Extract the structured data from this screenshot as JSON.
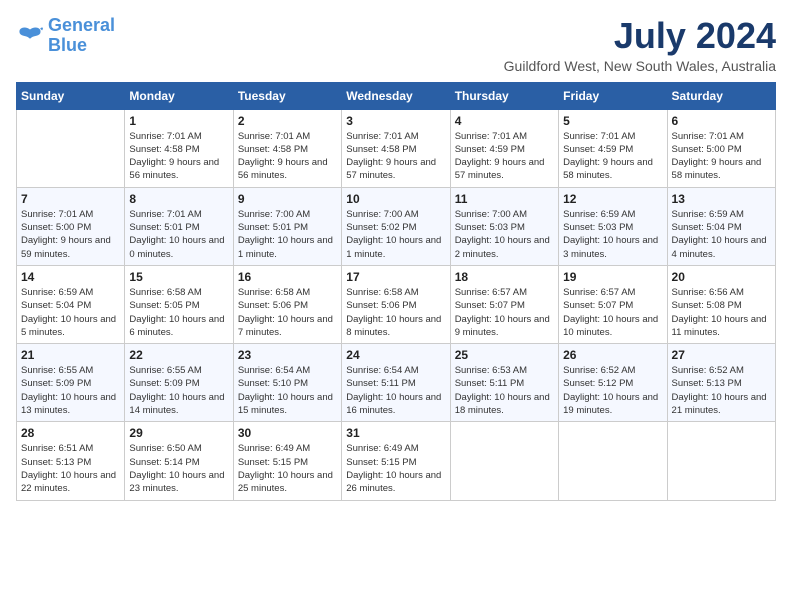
{
  "logo": {
    "line1": "General",
    "line2": "Blue"
  },
  "title": "July 2024",
  "subtitle": "Guildford West, New South Wales, Australia",
  "headers": [
    "Sunday",
    "Monday",
    "Tuesday",
    "Wednesday",
    "Thursday",
    "Friday",
    "Saturday"
  ],
  "weeks": [
    [
      {
        "day": "",
        "sunrise": "",
        "sunset": "",
        "daylight": ""
      },
      {
        "day": "1",
        "sunrise": "Sunrise: 7:01 AM",
        "sunset": "Sunset: 4:58 PM",
        "daylight": "Daylight: 9 hours and 56 minutes."
      },
      {
        "day": "2",
        "sunrise": "Sunrise: 7:01 AM",
        "sunset": "Sunset: 4:58 PM",
        "daylight": "Daylight: 9 hours and 56 minutes."
      },
      {
        "day": "3",
        "sunrise": "Sunrise: 7:01 AM",
        "sunset": "Sunset: 4:58 PM",
        "daylight": "Daylight: 9 hours and 57 minutes."
      },
      {
        "day": "4",
        "sunrise": "Sunrise: 7:01 AM",
        "sunset": "Sunset: 4:59 PM",
        "daylight": "Daylight: 9 hours and 57 minutes."
      },
      {
        "day": "5",
        "sunrise": "Sunrise: 7:01 AM",
        "sunset": "Sunset: 4:59 PM",
        "daylight": "Daylight: 9 hours and 58 minutes."
      },
      {
        "day": "6",
        "sunrise": "Sunrise: 7:01 AM",
        "sunset": "Sunset: 5:00 PM",
        "daylight": "Daylight: 9 hours and 58 minutes."
      }
    ],
    [
      {
        "day": "7",
        "sunrise": "Sunrise: 7:01 AM",
        "sunset": "Sunset: 5:00 PM",
        "daylight": "Daylight: 9 hours and 59 minutes."
      },
      {
        "day": "8",
        "sunrise": "Sunrise: 7:01 AM",
        "sunset": "Sunset: 5:01 PM",
        "daylight": "Daylight: 10 hours and 0 minutes."
      },
      {
        "day": "9",
        "sunrise": "Sunrise: 7:00 AM",
        "sunset": "Sunset: 5:01 PM",
        "daylight": "Daylight: 10 hours and 1 minute."
      },
      {
        "day": "10",
        "sunrise": "Sunrise: 7:00 AM",
        "sunset": "Sunset: 5:02 PM",
        "daylight": "Daylight: 10 hours and 1 minute."
      },
      {
        "day": "11",
        "sunrise": "Sunrise: 7:00 AM",
        "sunset": "Sunset: 5:03 PM",
        "daylight": "Daylight: 10 hours and 2 minutes."
      },
      {
        "day": "12",
        "sunrise": "Sunrise: 6:59 AM",
        "sunset": "Sunset: 5:03 PM",
        "daylight": "Daylight: 10 hours and 3 minutes."
      },
      {
        "day": "13",
        "sunrise": "Sunrise: 6:59 AM",
        "sunset": "Sunset: 5:04 PM",
        "daylight": "Daylight: 10 hours and 4 minutes."
      }
    ],
    [
      {
        "day": "14",
        "sunrise": "Sunrise: 6:59 AM",
        "sunset": "Sunset: 5:04 PM",
        "daylight": "Daylight: 10 hours and 5 minutes."
      },
      {
        "day": "15",
        "sunrise": "Sunrise: 6:58 AM",
        "sunset": "Sunset: 5:05 PM",
        "daylight": "Daylight: 10 hours and 6 minutes."
      },
      {
        "day": "16",
        "sunrise": "Sunrise: 6:58 AM",
        "sunset": "Sunset: 5:06 PM",
        "daylight": "Daylight: 10 hours and 7 minutes."
      },
      {
        "day": "17",
        "sunrise": "Sunrise: 6:58 AM",
        "sunset": "Sunset: 5:06 PM",
        "daylight": "Daylight: 10 hours and 8 minutes."
      },
      {
        "day": "18",
        "sunrise": "Sunrise: 6:57 AM",
        "sunset": "Sunset: 5:07 PM",
        "daylight": "Daylight: 10 hours and 9 minutes."
      },
      {
        "day": "19",
        "sunrise": "Sunrise: 6:57 AM",
        "sunset": "Sunset: 5:07 PM",
        "daylight": "Daylight: 10 hours and 10 minutes."
      },
      {
        "day": "20",
        "sunrise": "Sunrise: 6:56 AM",
        "sunset": "Sunset: 5:08 PM",
        "daylight": "Daylight: 10 hours and 11 minutes."
      }
    ],
    [
      {
        "day": "21",
        "sunrise": "Sunrise: 6:55 AM",
        "sunset": "Sunset: 5:09 PM",
        "daylight": "Daylight: 10 hours and 13 minutes."
      },
      {
        "day": "22",
        "sunrise": "Sunrise: 6:55 AM",
        "sunset": "Sunset: 5:09 PM",
        "daylight": "Daylight: 10 hours and 14 minutes."
      },
      {
        "day": "23",
        "sunrise": "Sunrise: 6:54 AM",
        "sunset": "Sunset: 5:10 PM",
        "daylight": "Daylight: 10 hours and 15 minutes."
      },
      {
        "day": "24",
        "sunrise": "Sunrise: 6:54 AM",
        "sunset": "Sunset: 5:11 PM",
        "daylight": "Daylight: 10 hours and 16 minutes."
      },
      {
        "day": "25",
        "sunrise": "Sunrise: 6:53 AM",
        "sunset": "Sunset: 5:11 PM",
        "daylight": "Daylight: 10 hours and 18 minutes."
      },
      {
        "day": "26",
        "sunrise": "Sunrise: 6:52 AM",
        "sunset": "Sunset: 5:12 PM",
        "daylight": "Daylight: 10 hours and 19 minutes."
      },
      {
        "day": "27",
        "sunrise": "Sunrise: 6:52 AM",
        "sunset": "Sunset: 5:13 PM",
        "daylight": "Daylight: 10 hours and 21 minutes."
      }
    ],
    [
      {
        "day": "28",
        "sunrise": "Sunrise: 6:51 AM",
        "sunset": "Sunset: 5:13 PM",
        "daylight": "Daylight: 10 hours and 22 minutes."
      },
      {
        "day": "29",
        "sunrise": "Sunrise: 6:50 AM",
        "sunset": "Sunset: 5:14 PM",
        "daylight": "Daylight: 10 hours and 23 minutes."
      },
      {
        "day": "30",
        "sunrise": "Sunrise: 6:49 AM",
        "sunset": "Sunset: 5:15 PM",
        "daylight": "Daylight: 10 hours and 25 minutes."
      },
      {
        "day": "31",
        "sunrise": "Sunrise: 6:49 AM",
        "sunset": "Sunset: 5:15 PM",
        "daylight": "Daylight: 10 hours and 26 minutes."
      },
      {
        "day": "",
        "sunrise": "",
        "sunset": "",
        "daylight": ""
      },
      {
        "day": "",
        "sunrise": "",
        "sunset": "",
        "daylight": ""
      },
      {
        "day": "",
        "sunrise": "",
        "sunset": "",
        "daylight": ""
      }
    ]
  ]
}
